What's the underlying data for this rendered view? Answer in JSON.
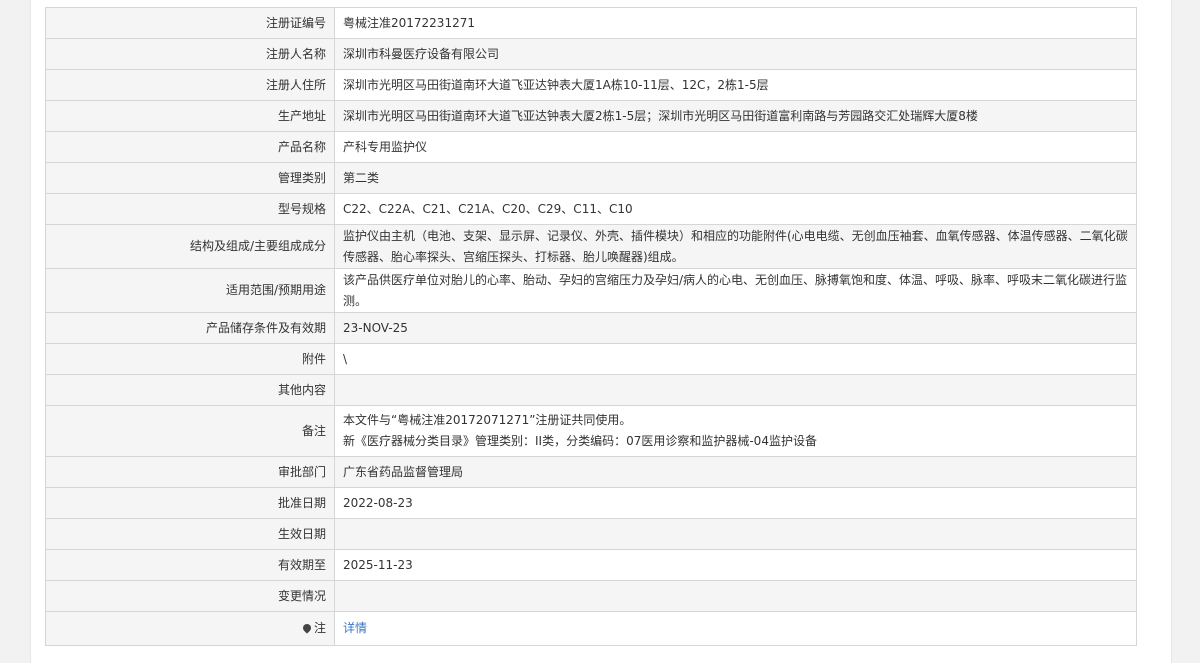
{
  "fields": [
    {
      "label": "注册证编号",
      "value": "粤械注准20172231271"
    },
    {
      "label": "注册人名称",
      "value": "深圳市科曼医疗设备有限公司"
    },
    {
      "label": "注册人住所",
      "value": "深圳市光明区马田街道南环大道飞亚达钟表大厦1A栋10-11层、12C，2栋1-5层"
    },
    {
      "label": "生产地址",
      "value": "深圳市光明区马田街道南环大道飞亚达钟表大厦2栋1-5层；深圳市光明区马田街道富利南路与芳园路交汇处瑞辉大厦8楼"
    },
    {
      "label": "产品名称",
      "value": "产科专用监护仪"
    },
    {
      "label": "管理类别",
      "value": "第二类"
    },
    {
      "label": "型号规格",
      "value": "C22、C22A、C21、C21A、C20、C29、C11、C10"
    },
    {
      "label": "结构及组成/主要组成成分",
      "value": "监护仪由主机（电池、支架、显示屏、记录仪、外壳、插件模块）和相应的功能附件(心电电缆、无创血压袖套、血氧传感器、体温传感器、二氧化碳传感器、胎心率探头、宫缩压探头、打标器、胎儿唤醒器)组成。"
    },
    {
      "label": "适用范围/预期用途",
      "value": "该产品供医疗单位对胎儿的心率、胎动、孕妇的宫缩压力及孕妇/病人的心电、无创血压、脉搏氧饱和度、体温、呼吸、脉率、呼吸末二氧化碳进行监测。"
    },
    {
      "label": "产品储存条件及有效期",
      "value": "23-NOV-25"
    },
    {
      "label": "附件",
      "value": "\\"
    },
    {
      "label": "其他内容",
      "value": ""
    },
    {
      "label": "备注",
      "value_lines": [
        "本文件与“粤械注准20172071271”注册证共同使用。",
        "新《医疗器械分类目录》管理类别：II类，分类编码：07医用诊察和监护器械-04监护设备"
      ]
    },
    {
      "label": "审批部门",
      "value": "广东省药品监督管理局"
    },
    {
      "label": "批准日期",
      "value": "2022-08-23"
    },
    {
      "label": "生效日期",
      "value": ""
    },
    {
      "label": "有效期至",
      "value": "2025-11-23"
    },
    {
      "label": "变更情况",
      "value": ""
    },
    {
      "label": "注",
      "icon": "map-pin-icon",
      "link_text": "详情"
    }
  ],
  "colors": {
    "label_bg": "#f5f5f5",
    "border": "#d6d6d6",
    "link": "#3a77c5"
  }
}
